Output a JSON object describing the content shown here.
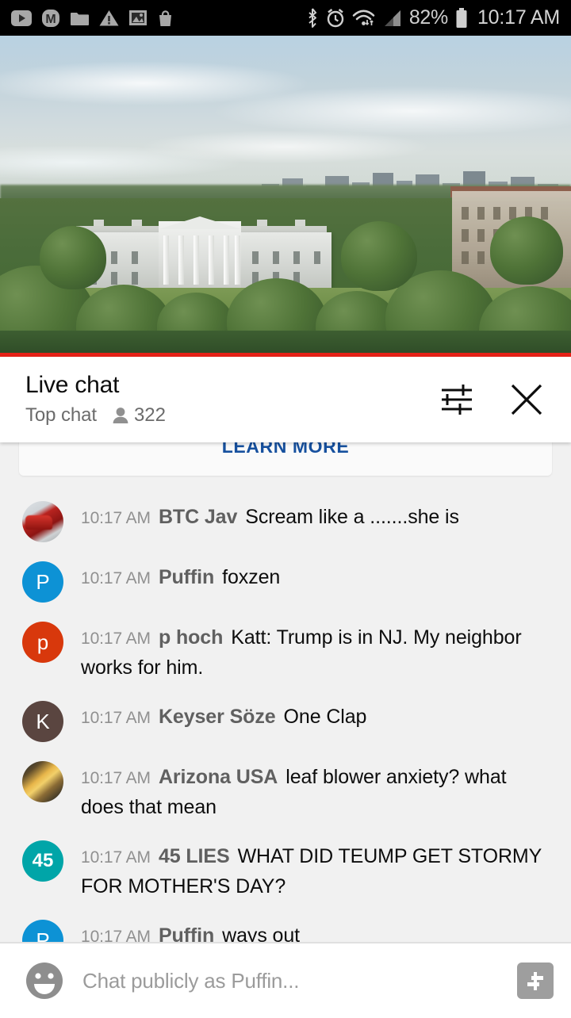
{
  "status_bar": {
    "icons_left": [
      "youtube-icon",
      "m-badge-icon",
      "folder-icon",
      "warning-triangle-icon",
      "photo-icon",
      "shopping-bag-icon"
    ],
    "icons_right": [
      "bluetooth-icon",
      "alarm-clock-icon",
      "wifi-icon",
      "cellular-signal-icon",
      "battery-icon"
    ],
    "battery_percent": "82%",
    "clock": "10:17 AM"
  },
  "video": {
    "scene_description": "White House aerial view",
    "progress_color": "#e62117",
    "progress_percent": 100
  },
  "chat_header": {
    "title": "Live chat",
    "mode": "Top chat",
    "viewer_count": "322",
    "viewer_icon": "person-icon",
    "settings_icon": "tune-sliders-icon",
    "close_icon": "close-x-icon"
  },
  "banner": {
    "learn_more": "LEARN MORE",
    "link_color": "#16509e"
  },
  "messages": [
    {
      "time": "10:17 AM",
      "author": "BTC Jav",
      "text": "Scream like a .......she is",
      "avatar_type": "photo",
      "avatar_class": "avatar-photo-car",
      "avatar_initial": ""
    },
    {
      "time": "10:17 AM",
      "author": "Puffin",
      "text": "foxzen",
      "avatar_type": "initial",
      "avatar_color": "#0d92d5",
      "avatar_initial": "P"
    },
    {
      "time": "10:17 AM",
      "author": "p hoch",
      "text": "Katt: Trump is in NJ. My neighbor works for him.",
      "avatar_type": "initial",
      "avatar_color": "#d8380c",
      "avatar_initial": "p"
    },
    {
      "time": "10:17 AM",
      "author": "Keyser Söze",
      "text": "One Clap",
      "avatar_type": "initial",
      "avatar_color": "#5a4540",
      "avatar_initial": "K"
    },
    {
      "time": "10:17 AM",
      "author": "Arizona USA",
      "text": "leaf blower anxiety? what does that mean",
      "avatar_type": "photo",
      "avatar_class": "avatar-photo-sun",
      "avatar_initial": ""
    },
    {
      "time": "10:17 AM",
      "author": "45 LIES",
      "text": "WHAT DID TEUMP GET STORMY FOR MOTHER'S DAY?",
      "avatar_type": "initial",
      "avatar_color": "#00a5a8",
      "avatar_initial": "45"
    },
    {
      "time": "10:17 AM",
      "author": "Puffin",
      "text": "ways out",
      "avatar_type": "initial",
      "avatar_color": "#0d92d5",
      "avatar_initial": "P"
    }
  ],
  "input_bar": {
    "emoji_icon": "emoji-smiley-icon",
    "placeholder": "Chat publicly as Puffin...",
    "value": "",
    "superchat_icon": "dollar-bill-icon"
  }
}
